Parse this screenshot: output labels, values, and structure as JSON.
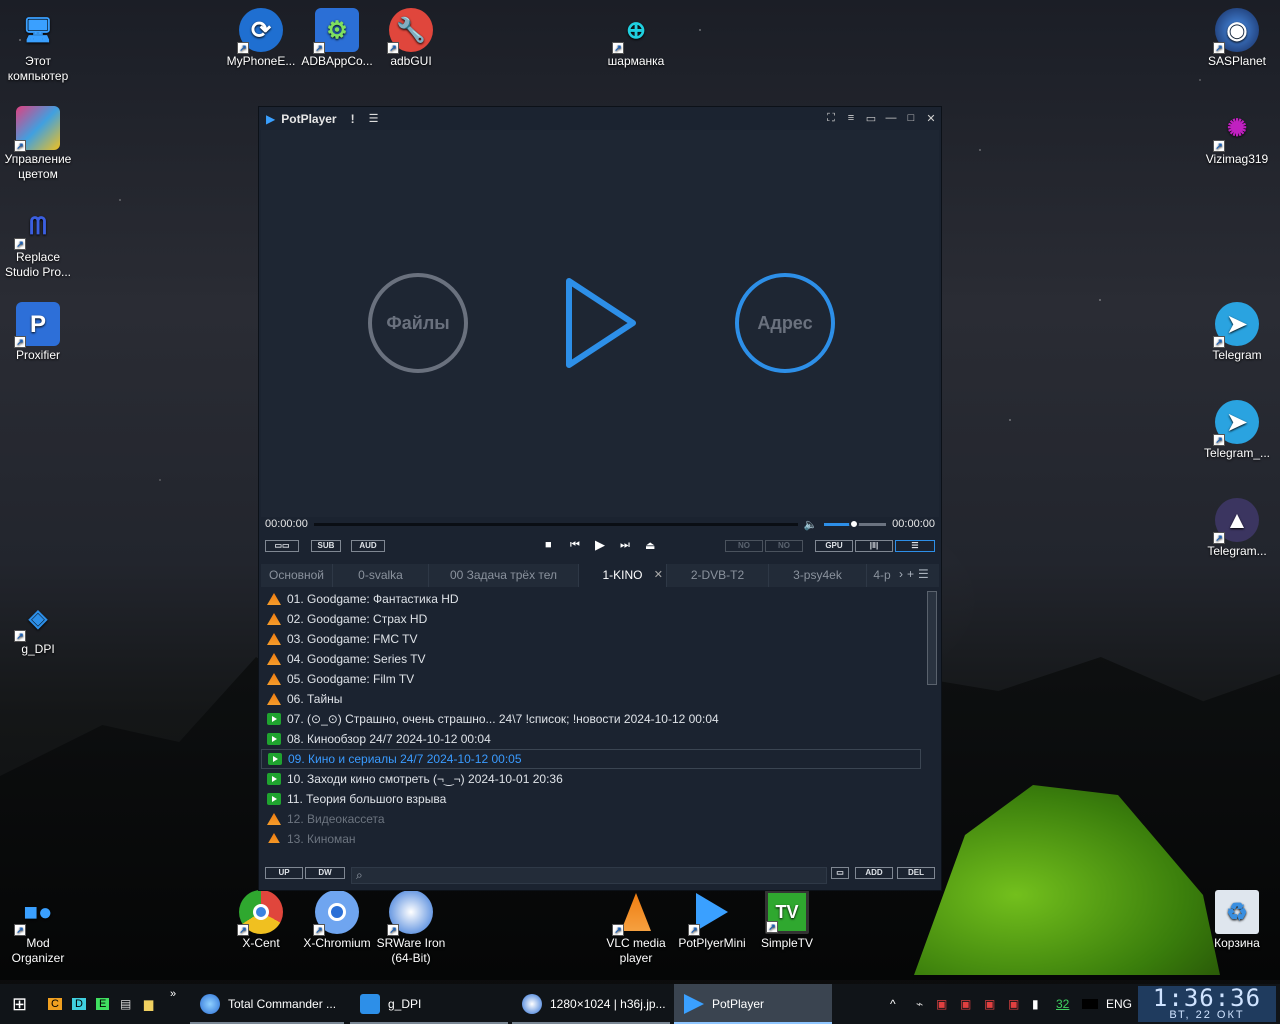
{
  "desktop_icons": [
    {
      "label": "Этот компьютер",
      "icon": "computer-icon",
      "color": "#3aa0ff"
    },
    {
      "label": "Управление цветом",
      "icon": "color-management-icon",
      "color": "#e04080"
    },
    {
      "label": "Replace Studio Pro...",
      "icon": "replace-studio-icon",
      "color": "#2b3fa8"
    },
    {
      "label": "Proxifier",
      "icon": "proxifier-icon",
      "color": "#2d6fd8"
    },
    {
      "label": "g_DPI",
      "icon": "gdpi-icon",
      "color": "#2d8fe8"
    },
    {
      "label": "Mod Organizer",
      "icon": "mod-organizer-icon",
      "color": "#3aa0ff"
    },
    {
      "label": "MyPhoneE...",
      "icon": "myphone-icon",
      "color": "#1f6fd1"
    },
    {
      "label": "ADBAppCo...",
      "icon": "adb-android-icon",
      "color": "#2b6fd6"
    },
    {
      "label": "adbGUI",
      "icon": "adbgui-wrench-icon",
      "color": "#e0463c"
    },
    {
      "label": "шарманка",
      "icon": "sharmanka-icon",
      "color": "#20d0e0"
    },
    {
      "label": "SASPlanet",
      "icon": "sasplanet-icon",
      "color": "#2e5fbf"
    },
    {
      "label": "Vizimag319",
      "icon": "vizimag-icon",
      "color": "#c020c0"
    },
    {
      "label": "Telegram",
      "icon": "telegram-icon",
      "color": "#2aa3e0"
    },
    {
      "label": "Telegram_...",
      "icon": "telegram-icon",
      "color": "#2aa3e0"
    },
    {
      "label": "Telegram...",
      "icon": "telegram-alt-icon",
      "color": "#6a5fb0"
    },
    {
      "label": "X-Cent",
      "icon": "chrome-icon",
      "color": "#e0b020"
    },
    {
      "label": "X-Chromium",
      "icon": "chromium-icon",
      "color": "#3b82e0"
    },
    {
      "label": "SRWare Iron (64-Bit)",
      "icon": "iron-browser-icon",
      "color": "#2b6fd6"
    },
    {
      "label": "VLC media player",
      "icon": "vlc-icon",
      "color": "#f07d10"
    },
    {
      "label": "PotPlyerMini",
      "icon": "potplayer-icon",
      "color": "#3aa0ff"
    },
    {
      "label": "SimpleTV",
      "icon": "tv-icon",
      "color": "#2fa82f"
    },
    {
      "label": "Корзина",
      "icon": "recycle-bin-icon",
      "color": "#b8c4d0"
    }
  ],
  "player": {
    "title": "PotPlayer",
    "bang": "!",
    "files_label": "Файлы",
    "address_label": "Адрес",
    "time_current": "00:00:00",
    "time_total": "00:00:00",
    "volume_level": 0.4,
    "seek_progress": 0,
    "buttons": {
      "sub": "SUB",
      "aud": "AUD",
      "no1": "NO",
      "no2": "NO",
      "gpu": "GPU",
      "up": "UP",
      "dw": "DW",
      "add": "ADD",
      "del": "DEL"
    },
    "tabs": [
      {
        "label": "Основной"
      },
      {
        "label": "0-svalka"
      },
      {
        "label": "00 Задача трёх тел"
      },
      {
        "label": "1-KINO"
      },
      {
        "label": "2-DVB-T2"
      },
      {
        "label": "3-psy4ek"
      },
      {
        "label": "4-p"
      }
    ],
    "playlist": [
      {
        "text": "01. Goodgame: Фантастика HD",
        "type": "cone"
      },
      {
        "text": "02. Goodgame: Страх HD",
        "type": "cone"
      },
      {
        "text": "03. Goodgame: FMC TV",
        "type": "cone"
      },
      {
        "text": "04. Goodgame: Series TV",
        "type": "cone"
      },
      {
        "text": "05. Goodgame: Film TV",
        "type": "cone"
      },
      {
        "text": "06. Тайны",
        "type": "cone"
      },
      {
        "text": "07. (⊙_⊙) Страшно, очень страшно... 24\\7 !список; !новости 2024-10-12 00:04",
        "type": "live"
      },
      {
        "text": "08. Кинообзор  24/7 2024-10-12 00:04",
        "type": "live"
      },
      {
        "text": "09. Кино и сериалы 24/7 2024-10-12 00:05",
        "type": "live"
      },
      {
        "text": "10. Заходи кино смотреть (¬‿¬) 2024-10-01 20:36",
        "type": "live"
      },
      {
        "text": "11. Теория большого взрыва",
        "type": "live"
      },
      {
        "text": "12. Видеокассета",
        "type": "cone"
      },
      {
        "text": "13. Киноман",
        "type": "cone"
      }
    ]
  },
  "taskbar": {
    "pinned": [
      "C",
      "D",
      "E"
    ],
    "overflow": "»",
    "items": [
      {
        "label": "Total Commander ..."
      },
      {
        "label": "g_DPI"
      },
      {
        "label": "1280×1024 | h36j.jp..."
      },
      {
        "label": "PotPlayer"
      }
    ],
    "tray_number": "32",
    "lang": "ENG",
    "time": "1:36:36",
    "date": "ВТ, 22  ОКТ"
  }
}
